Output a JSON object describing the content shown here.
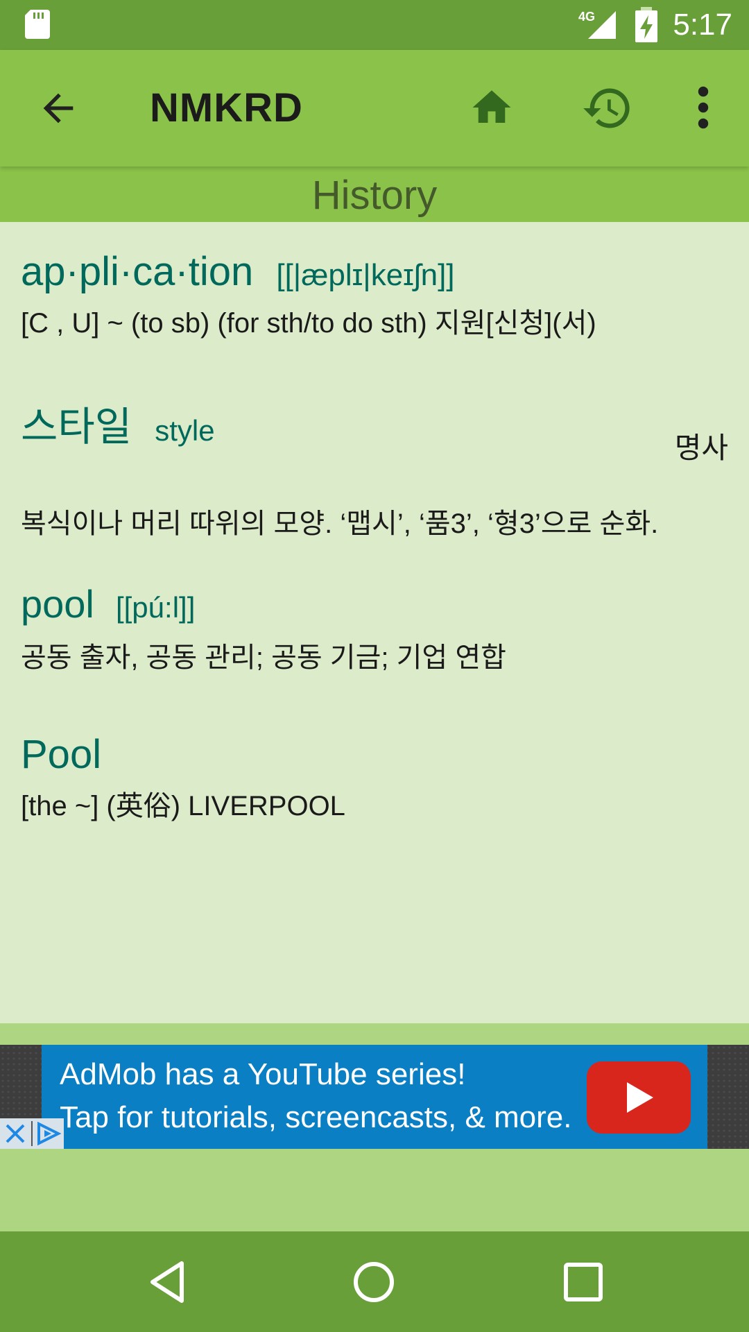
{
  "status_bar": {
    "network": "4G",
    "time": "5:17"
  },
  "app_bar": {
    "title": "NMKRD"
  },
  "section_header": {
    "title": "History"
  },
  "entries": [
    {
      "headword": "ap·pli·ca·tion",
      "pronunciation": "[[|æplɪ|keɪʃn]]",
      "definition": "[C , U] ~ (to sb) (for sth/to do sth) 지원[신청](서)"
    },
    {
      "headword": "스타일",
      "pronunciation": "style",
      "part_of_speech": "명사",
      "definition": "복식이나 머리 따위의 모양. ‘맵시’, ‘품3’, ‘형3’으로 순화."
    },
    {
      "headword": "pool",
      "pronunciation": "[[pú:l]]",
      "definition": "공동 출자, 공동 관리; 공동 기금; 기업 연합"
    },
    {
      "headword": "Pool",
      "definition": "[the ~] (英俗) LIVERPOOL"
    }
  ],
  "ad": {
    "line1": "AdMob has a YouTube series!",
    "line2": "Tap for tutorials, screencasts, & more."
  },
  "colors": {
    "status_bar": "#689f38",
    "app_bar": "#8bc34a",
    "content_bg": "#dcebc9",
    "headword": "#00695c",
    "ad_blue": "#0a7fc4"
  },
  "icons": [
    "sd-card-icon",
    "signal-icon",
    "battery-icon",
    "back-arrow-icon",
    "home-icon",
    "history-icon",
    "more-vert-icon",
    "youtube-play-icon",
    "close-icon",
    "adchoices-icon",
    "nav-back-icon",
    "nav-home-icon",
    "nav-recents-icon"
  ]
}
